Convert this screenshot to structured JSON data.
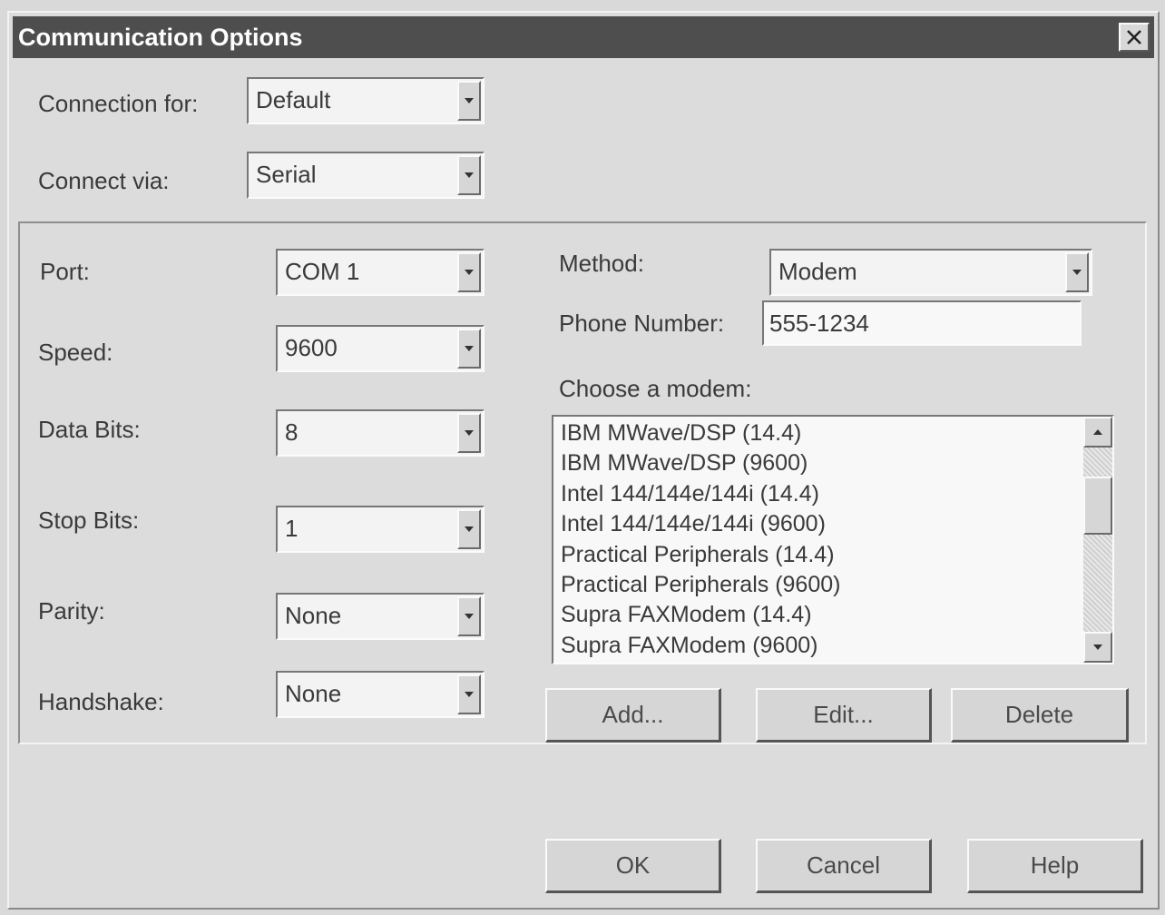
{
  "window": {
    "title": "Communication Options",
    "close_glyph": "✕"
  },
  "connection_for": {
    "label": "Connection for:",
    "value": "Default"
  },
  "connect_via": {
    "label": "Connect via:",
    "value": "Serial"
  },
  "serial": {
    "port": {
      "label": "Port:",
      "value": "COM 1"
    },
    "speed": {
      "label": "Speed:",
      "value": "9600"
    },
    "data_bits": {
      "label": "Data Bits:",
      "value": "8"
    },
    "stop_bits": {
      "label": "Stop Bits:",
      "value": "1"
    },
    "parity": {
      "label": "Parity:",
      "value": "None"
    },
    "handshake": {
      "label": "Handshake:",
      "value": "None"
    }
  },
  "modem": {
    "method": {
      "label": "Method:",
      "value": "Modem"
    },
    "phone": {
      "label": "Phone Number:",
      "value": "555-1234"
    },
    "choose_label": "Choose a modem:",
    "list": [
      "IBM MWave/DSP (14.4)",
      "IBM MWave/DSP (9600)",
      "Intel 144/144e/144i (14.4)",
      "Intel 144/144e/144i (9600)",
      "Practical Peripherals (14.4)",
      "Practical Peripherals (9600)",
      "Supra FAXModem (14.4)",
      "Supra FAXModem (9600)"
    ],
    "add_label": "Add...",
    "edit_label": "Edit...",
    "delete_label": "Delete"
  },
  "footer": {
    "ok_label": "OK",
    "cancel_label": "Cancel",
    "help_label": "Help"
  },
  "colors": {
    "titlebar": "#4e4e4e",
    "face": "#dcdcdc",
    "field": "#f3f3f3"
  }
}
